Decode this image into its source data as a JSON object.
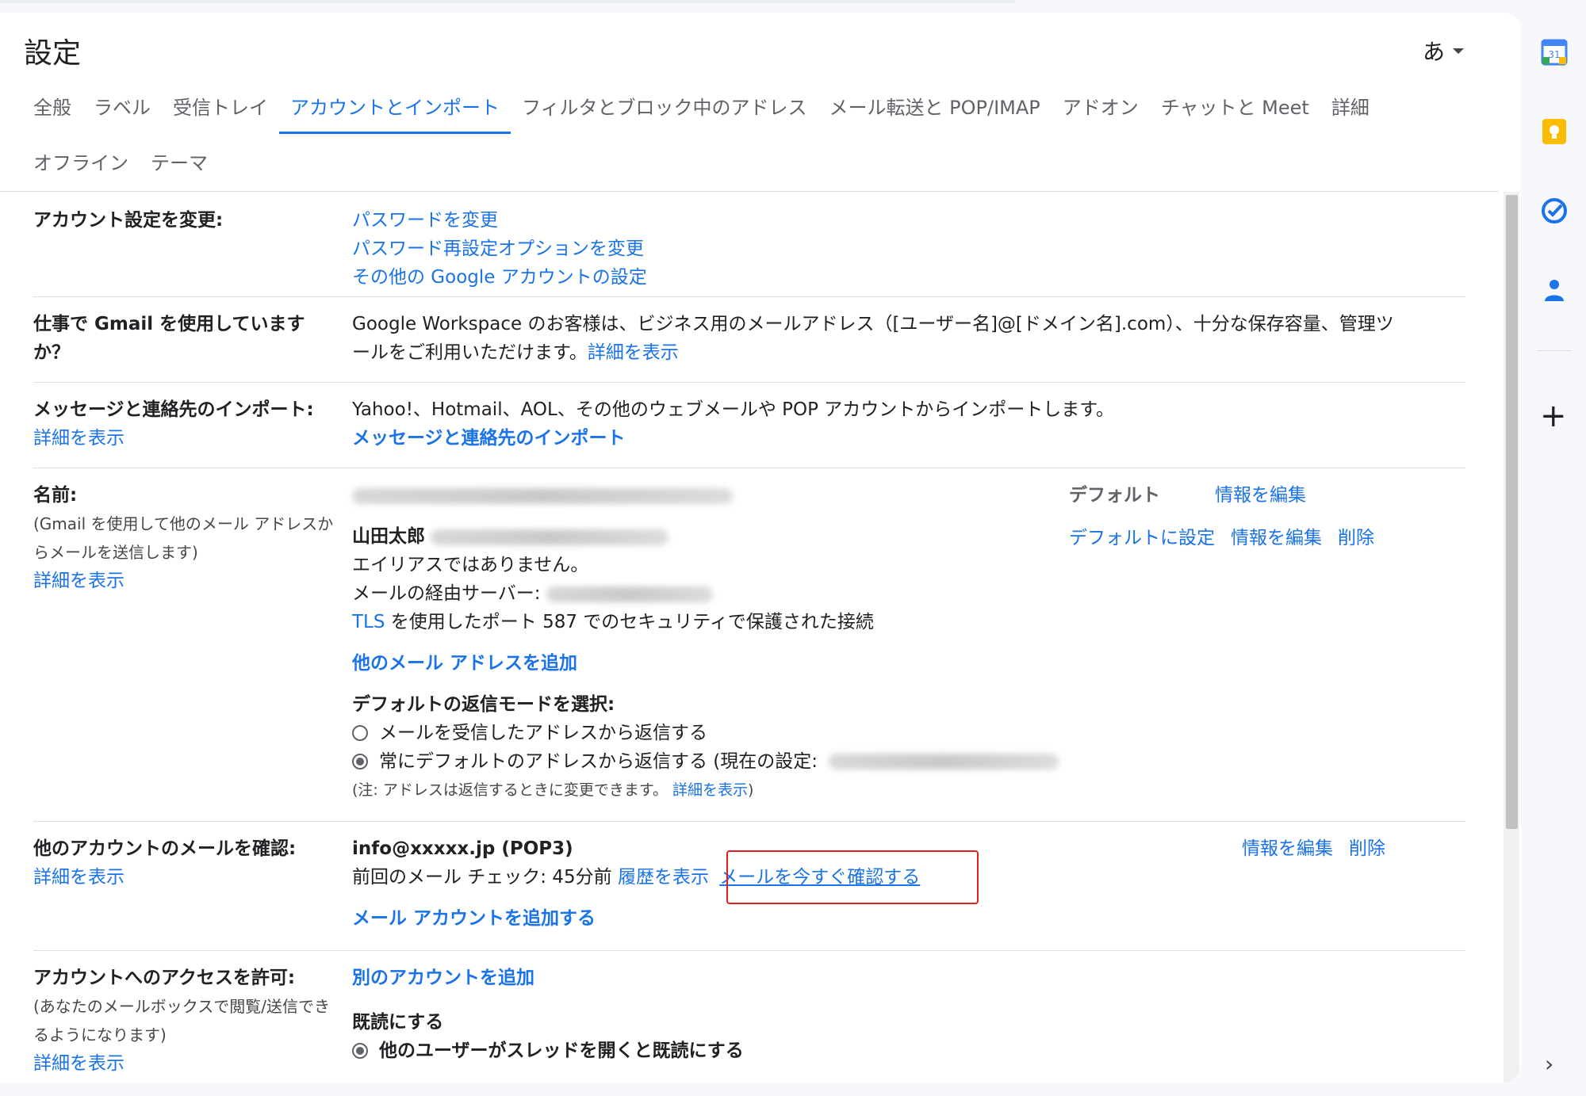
{
  "header": {
    "title": "設定",
    "ime_label": "あ"
  },
  "tabs_row1": [
    "全般",
    "ラベル",
    "受信トレイ",
    "アカウントとインポート",
    "フィルタとブロック中のアドレス",
    "メール転送と POP/IMAP",
    "アドオン",
    "チャットと Meet",
    "詳細"
  ],
  "tabs_row2": [
    "オフライン",
    "テーマ"
  ],
  "account_settings": {
    "label": "アカウント設定を変更:",
    "links": [
      "パスワードを変更",
      "パスワード再設定オプションを変更",
      "その他の Google アカウントの設定"
    ]
  },
  "workspace": {
    "label_line1": "仕事で Gmail を使用しています",
    "label_line2": "か？",
    "text_line1": "Google Workspace のお客様は、ビジネス用のメールアドレス（[ユーザー名]@[ドメイン名].com）、十分な保存容量、管理ツ",
    "text_line2": "ールをご利用いただけます。",
    "link": "詳細を表示"
  },
  "import": {
    "label": "メッセージと連絡先のインポート:",
    "learn_more": "詳細を表示",
    "text": "Yahoo!、Hotmail、AOL、その他のウェブメールや POP アカウントからインポートします。",
    "action": "メッセージと連絡先のインポート"
  },
  "name": {
    "label": "名前:",
    "sub1": "(Gmail を使用して他のメール アドレスか",
    "sub2": "らメールを送信します)",
    "learn_more": "詳細を表示",
    "default_text": "デフォルト",
    "edit_info": "情報を編集",
    "set_default": "デフォルトに設定",
    "delete": "削除",
    "second_name": "山田太郎",
    "not_alias": "エイリアスではありません。",
    "via_server": "メールの経由サーバー:",
    "tls": "TLS",
    "tls_rest": " を使用したポート 587 でのセキュリティで保護された接続",
    "add_address": "他のメール アドレスを追加",
    "reply_mode_title": "デフォルトの返信モードを選択:",
    "reply_opt1": "メールを受信したアドレスから返信する",
    "reply_opt2": "常にデフォルトのアドレスから返信する (現在の設定:",
    "note_prefix": "(注: アドレスは返信するときに変更できます。",
    "note_link": "詳細を表示",
    "note_suffix": ")"
  },
  "check_mail": {
    "label": "他のアカウントのメールを確認:",
    "learn_more": "詳細を表示",
    "account": "info@xxxxx.jp (POP3)",
    "last_check": "前回のメール チェック: 45分前",
    "history": "履歴を表示",
    "check_now": "メールを今すぐ確認する",
    "edit_info": "情報を編集",
    "delete": "削除",
    "add_account": "メール アカウントを追加する"
  },
  "grant_access": {
    "label": "アカウントへのアクセスを許可:",
    "sub1": "(あなたのメールボックスで閲覧/送信でき",
    "sub2": "るようになります)",
    "learn_more": "詳細を表示",
    "add_another": "別のアカウントを追加",
    "mark_read_title": "既読にする",
    "mark_read_opt": "他のユーザーがスレッドを開くと既読にする"
  },
  "side_panel": {
    "calendar_badge": "31",
    "icons": [
      "calendar-icon",
      "keep-icon",
      "tasks-icon",
      "contacts-icon",
      "add-icon",
      "chevron-right-icon"
    ]
  },
  "colors": {
    "link": "#1a73e8",
    "highlight": "#e02020"
  }
}
